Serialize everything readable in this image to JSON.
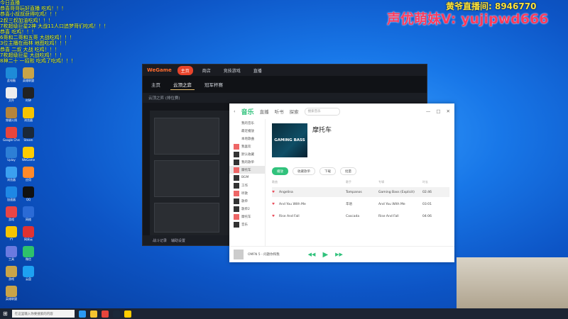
{
  "overlay": {
    "chat": [
      "今日直播",
      "恭喜哥哥玩好直播 吃鸡！！！",
      "恭喜小叔叔获得吃鸡！！！",
      "2叔三叔加油吃鸡！！！",
      "7枚超级巨星2神 大战11人口追梦哥们吃鸡！！！",
      "恭喜 吃鸡！！！",
      "6哥和二哥和五哥 大战吃鸡！！！",
      "3位主播在雨林 地图吃鸡！！！",
      "恭喜 二叔 大战 吃鸡！！！",
      "7枚超级巨星 大战吃鸡！！！",
      "8神二十 一招败 吃鸡了吃鸡！！！"
    ],
    "stream_id": "黄爷直播间: 8946770",
    "wechat": "声优萌妹V: yujipwd666"
  },
  "desktop_icons": [
    {
      "label": "此电脑",
      "color": "#1e8bd8"
    },
    {
      "label": "英雄联盟",
      "color": "#c9a448"
    },
    {
      "label": "文件",
      "color": "#eeeeee"
    },
    {
      "label": "时钟",
      "color": "#222222"
    },
    {
      "label": "穿越火线",
      "color": "#b5843b"
    },
    {
      "label": "浏览器",
      "color": "#f7c400"
    },
    {
      "label": "Google Chrome",
      "color": "#e8453c"
    },
    {
      "label": "Steam",
      "color": "#1b2838"
    },
    {
      "label": "Uplay",
      "color": "#2d7fd6"
    },
    {
      "label": "WeGame",
      "color": "#ffcc00"
    },
    {
      "label": "浏览器",
      "color": "#3ba0f0"
    },
    {
      "label": "应用",
      "color": "#ff8a2a"
    },
    {
      "label": "加速器",
      "color": "#1e88e5"
    },
    {
      "label": "QQ",
      "color": "#111111"
    },
    {
      "label": "游戏",
      "color": "#e84545"
    },
    {
      "label": "网络",
      "color": "#2b6bd6"
    },
    {
      "label": "YY",
      "color": "#f7c400"
    },
    {
      "label": "网易云",
      "color": "#e03232"
    },
    {
      "label": "工具",
      "color": "#6a7ae0"
    },
    {
      "label": "微信",
      "color": "#2ec26b"
    },
    {
      "label": "游戏",
      "color": "#c9a448"
    },
    {
      "label": "云盘",
      "color": "#1da1f2"
    },
    {
      "label": "英雄联盟",
      "color": "#c9a448"
    }
  ],
  "wegame": {
    "logo": "WeGame",
    "tabs": [
      "主页",
      "商店",
      "竞技游戏",
      "直播"
    ],
    "nav": [
      "主页",
      "云顶之弈",
      "冠军杯赛"
    ],
    "subbar": "云顶之弈 (排位赛)",
    "bottom": [
      "战斗记录",
      "辅助设置"
    ]
  },
  "music": {
    "brand": "音乐",
    "tabs": [
      "直播",
      "听书",
      "探索"
    ],
    "search": "搜索音乐",
    "sidebar": [
      "我的音乐",
      "最近播放",
      "本地歌曲",
      "我喜欢",
      "默认收藏",
      "我的歌单",
      "摩托车",
      "BGM",
      "工作",
      "听歌",
      "歌单",
      "歌单2",
      "摩托车",
      "音乐"
    ],
    "cover": "GAMING BASS",
    "playlist_title": "摩托车",
    "buttons": [
      "播放",
      "收藏歌单",
      "下载",
      "批量"
    ],
    "headers": [
      "歌曲",
      "歌手",
      "专辑",
      "时长"
    ],
    "rows": [
      {
        "title": "Angelina",
        "artist": "Tompanos",
        "album": "Gaming Bass (Explicit)",
        "time": "02:46"
      },
      {
        "title": "And You With Me",
        "artist": "华语",
        "album": "And You With Me",
        "time": "03:01"
      },
      {
        "title": "Rise And Fall",
        "artist": "Cascada",
        "album": "Rise And Fall",
        "time": "04:06"
      }
    ],
    "player_track": "OMFN 5 - 问题你和我",
    "player_sub": "主播你好"
  },
  "taskbar": {
    "search": "在这里输入你要搜索的内容"
  }
}
